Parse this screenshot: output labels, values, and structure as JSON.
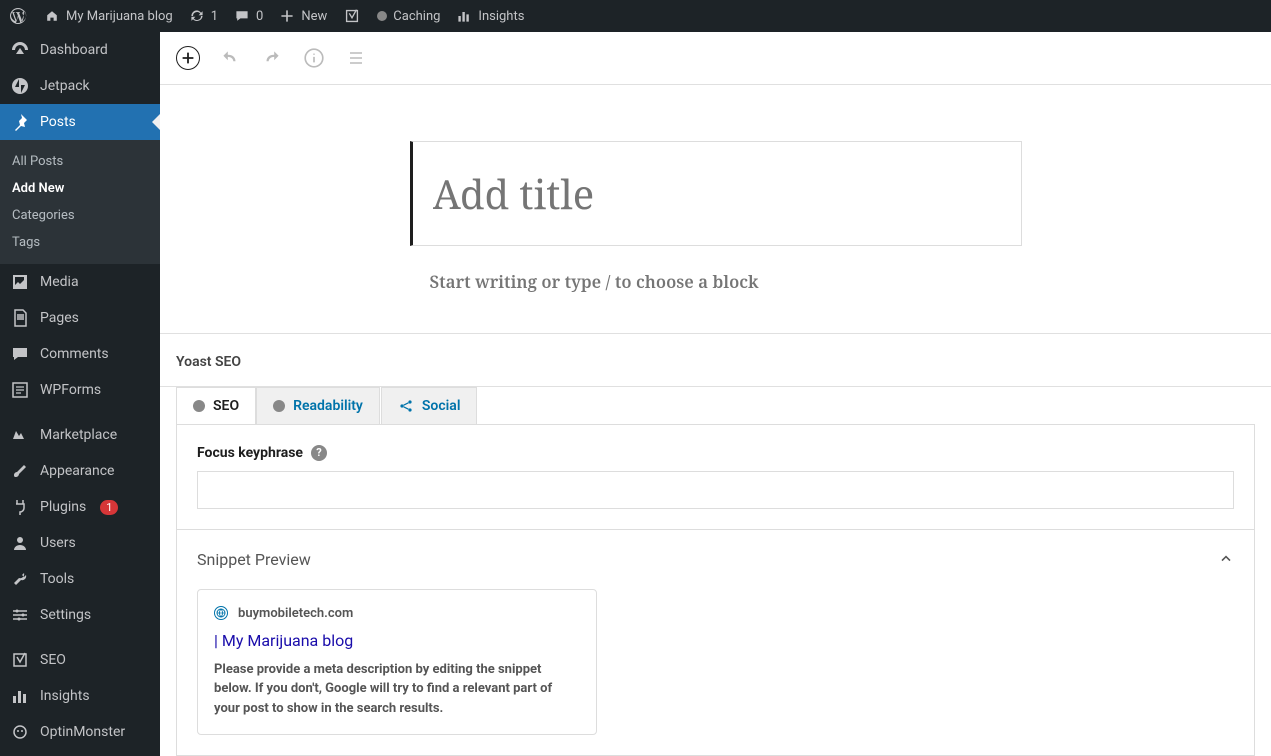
{
  "toolbar": {
    "site_title": "My Marijuana blog",
    "updates_count": "1",
    "comments_count": "0",
    "new_label": "New",
    "caching_label": "Caching",
    "insights_label": "Insights"
  },
  "sidebar": {
    "dashboard": "Dashboard",
    "jetpack": "Jetpack",
    "posts": "Posts",
    "posts_sub": {
      "all": "All Posts",
      "add": "Add New",
      "categories": "Categories",
      "tags": "Tags"
    },
    "media": "Media",
    "pages": "Pages",
    "comments": "Comments",
    "wpforms": "WPForms",
    "marketplace": "Marketplace",
    "appearance": "Appearance",
    "plugins": "Plugins",
    "plugins_badge": "1",
    "users": "Users",
    "tools": "Tools",
    "settings": "Settings",
    "seo": "SEO",
    "insights": "Insights",
    "optinmonster": "OptinMonster"
  },
  "editor": {
    "title_placeholder": "Add title",
    "body_prompt": "Start writing or type / to choose a block"
  },
  "yoast": {
    "panel_title": "Yoast SEO",
    "tabs": {
      "seo": "SEO",
      "readability": "Readability",
      "social": "Social"
    },
    "focus_label": "Focus keyphrase",
    "snippet_title": "Snippet Preview",
    "snippet": {
      "domain": "buymobiletech.com",
      "title": " | My Marijuana blog",
      "desc": "Please provide a meta description by editing the snippet below. If you don't, Google will try to find a relevant part of your post to show in the search results."
    }
  }
}
